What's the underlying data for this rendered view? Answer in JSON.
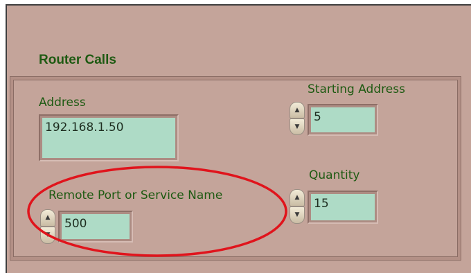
{
  "section": {
    "title": "Router Calls"
  },
  "address": {
    "label": "Address",
    "value": "192.168.1.50"
  },
  "remote_port": {
    "label": "Remote Port or Service Name",
    "value": "500"
  },
  "starting_address": {
    "label": "Starting Address",
    "value": "5"
  },
  "quantity": {
    "label": "Quantity",
    "value": "15"
  },
  "annotation": {
    "color": "#e0141c"
  },
  "colors": {
    "panel": "#c4a49a",
    "field": "#aedbc6",
    "label": "#1e5a12"
  }
}
